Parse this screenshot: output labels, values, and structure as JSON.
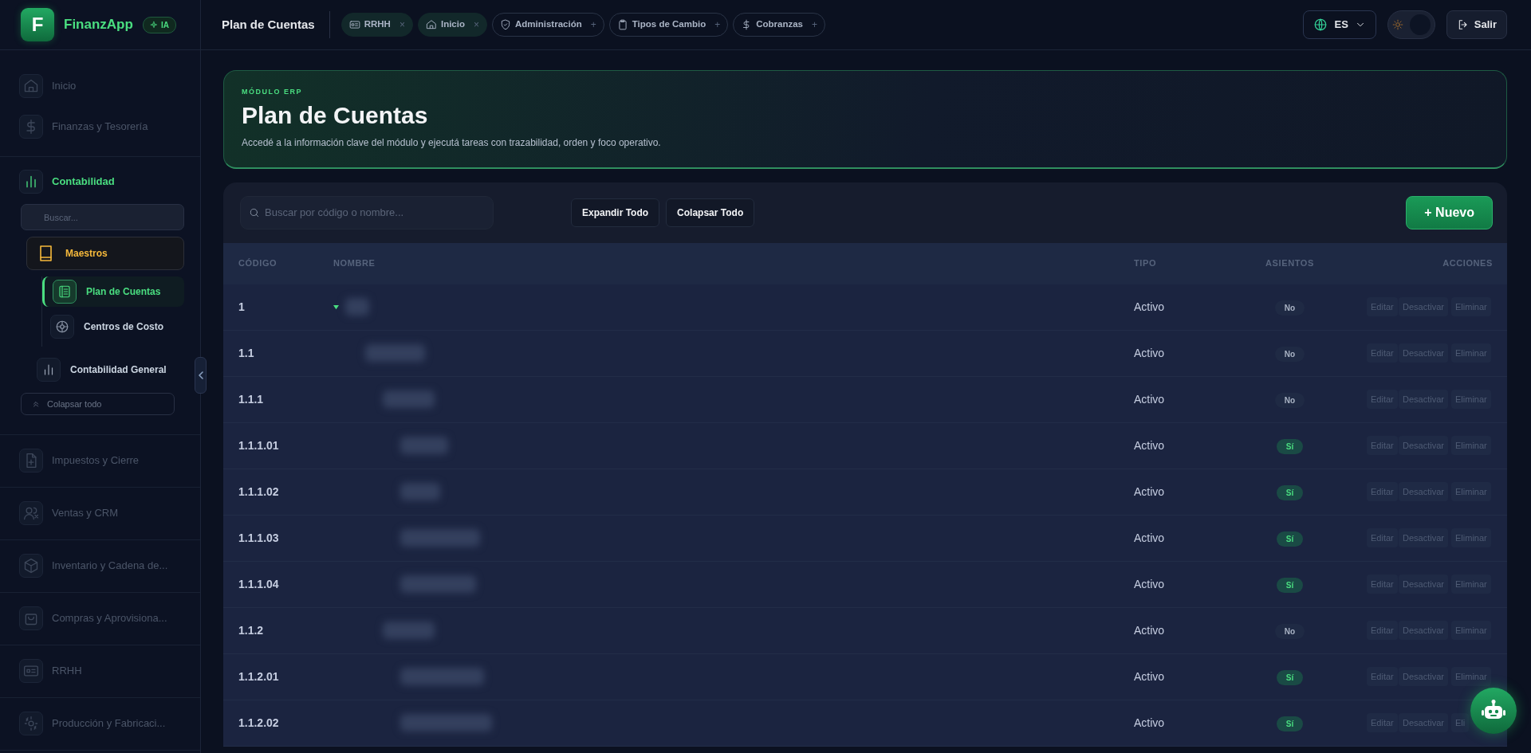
{
  "brand": {
    "logo_letter": "F",
    "name": "FinanzApp",
    "badge": "IA"
  },
  "sidebar": {
    "groups": [
      {
        "items": [
          {
            "label": "Inicio",
            "active": false
          },
          {
            "label": "Finanzas y Tesorería",
            "active": false
          }
        ]
      },
      {
        "items": [
          {
            "label": "Contabilidad",
            "active": true,
            "search": {
              "placeholder": "Buscar..."
            },
            "children": [
              {
                "label": "Maestros",
                "selected": true,
                "children": [
                  {
                    "label": "Plan de Cuentas",
                    "selected": true
                  },
                  {
                    "label": "Centros de Costo",
                    "selected": false
                  }
                ]
              },
              {
                "label": "Contabilidad General",
                "selected": false
              }
            ],
            "collapse_button": "Colapsar todo"
          }
        ]
      },
      {
        "items": [
          {
            "label": "Impuestos y Cierre",
            "active": false
          }
        ]
      },
      {
        "items": [
          {
            "label": "Ventas y CRM",
            "active": false
          }
        ]
      },
      {
        "items": [
          {
            "label": "Inventario y Cadena de...",
            "active": false
          }
        ]
      },
      {
        "items": [
          {
            "label": "Compras y Aprovisiona...",
            "active": false
          }
        ]
      },
      {
        "items": [
          {
            "label": "RRHH",
            "active": false
          }
        ]
      },
      {
        "items": [
          {
            "label": "Producción y Fabricaci...",
            "active": false
          }
        ]
      }
    ]
  },
  "topbar": {
    "page_title": "Plan de Cuentas",
    "tabs": [
      {
        "label": "RRHH",
        "open": true,
        "action": "×"
      },
      {
        "label": "Inicio",
        "open": true,
        "action": "×"
      },
      {
        "label": "Administración",
        "open": false,
        "action": "+"
      },
      {
        "label": "Tipos de Cambio",
        "open": false,
        "action": "+"
      },
      {
        "label": "Cobranzas",
        "open": false,
        "action": "+"
      }
    ],
    "language": "ES",
    "theme_toggle": {
      "dark": true
    },
    "logout": "Salir"
  },
  "header": {
    "eyebrow": "MÓDULO ERP",
    "title": "Plan de Cuentas",
    "description": "Accedé a la información clave del módulo y ejecutá tareas con trazabilidad, orden y foco operativo."
  },
  "toolbar": {
    "search": {
      "placeholder": "Buscar por código o nombre..."
    },
    "buttons": [
      "Expandir Todo",
      "Colapsar Todo"
    ],
    "new_button": "+ Nuevo"
  },
  "table": {
    "columns": [
      "CÓDIGO",
      "NOMBRE",
      "TIPO",
      "ASIENTOS",
      "ACCIONES"
    ],
    "rows": [
      {
        "code": "1",
        "type": "Activo",
        "entries": "No",
        "entries_on": false,
        "expanded": true,
        "actions": [
          "Editar",
          "Desactivar",
          "Eliminar"
        ],
        "children": [
          {
            "code": "1.1",
            "type": "Activo",
            "entries": "No",
            "entries_on": false,
            "actions": [
              "Editar",
              "Desactivar",
              "Eliminar"
            ],
            "children": [
              {
                "code": "1.1.1",
                "type": "Activo",
                "entries": "No",
                "entries_on": false,
                "actions": [
                  "Editar",
                  "Desactivar",
                  "Eliminar"
                ],
                "children": [
                  {
                    "code": "1.1.1.01",
                    "type": "Activo",
                    "entries": "Sí",
                    "entries_on": true,
                    "actions": [
                      "Editar",
                      "Desactivar",
                      "Eliminar"
                    ]
                  },
                  {
                    "code": "1.1.1.02",
                    "type": "Activo",
                    "entries": "Sí",
                    "entries_on": true,
                    "actions": [
                      "Editar",
                      "Desactivar",
                      "Eliminar"
                    ]
                  },
                  {
                    "code": "1.1.1.03",
                    "type": "Activo",
                    "entries": "Sí",
                    "entries_on": true,
                    "actions": [
                      "Editar",
                      "Desactivar",
                      "Eliminar"
                    ]
                  },
                  {
                    "code": "1.1.1.04",
                    "type": "Activo",
                    "entries": "Sí",
                    "entries_on": true,
                    "actions": [
                      "Editar",
                      "Desactivar",
                      "Eliminar"
                    ]
                  }
                ]
              },
              {
                "code": "1.1.2",
                "type": "Activo",
                "entries": "No",
                "entries_on": false,
                "actions": [
                  "Editar",
                  "Desactivar",
                  "Eliminar"
                ],
                "children": [
                  {
                    "code": "1.1.2.01",
                    "type": "Activo",
                    "entries": "Sí",
                    "entries_on": true,
                    "actions": [
                      "Editar",
                      "Desactivar",
                      "Eliminar"
                    ]
                  },
                  {
                    "code": "1.1.2.02",
                    "type": "Activo",
                    "entries": "Sí",
                    "entries_on": true,
                    "actions": [
                      "Editar",
                      "Desactivar",
                      "Eli"
                    ]
                  }
                ]
              }
            ]
          }
        ]
      }
    ]
  }
}
